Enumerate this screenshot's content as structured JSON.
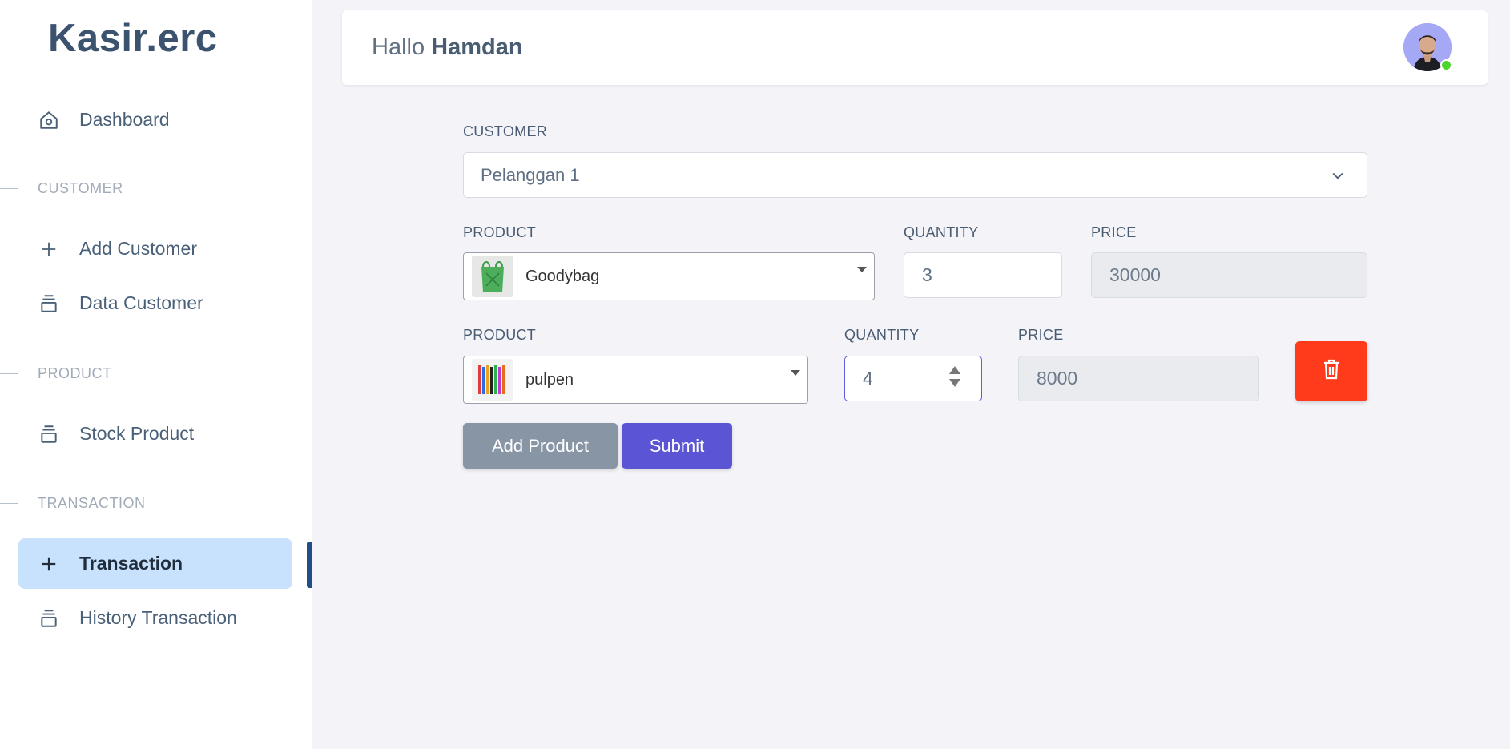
{
  "app": {
    "brand": "Kasir.erc"
  },
  "sidebar": {
    "dashboard": "Dashboard",
    "sections": {
      "customer": "CUSTOMER",
      "product": "PRODUCT",
      "transaction": "TRANSACTION"
    },
    "items": {
      "add_customer": "Add Customer",
      "data_customer": "Data Customer",
      "stock_product": "Stock Product",
      "transaction": "Transaction",
      "history_transaction": "History Transaction"
    }
  },
  "header": {
    "greeting_prefix": "Hallo",
    "user_name": "Hamdan"
  },
  "form": {
    "customer_label": "CUSTOMER",
    "customer_value": "Pelanggan 1",
    "rows": [
      {
        "product_label": "PRODUCT",
        "product_value": "Goodybag",
        "quantity_label": "QUANTITY",
        "quantity_value": "3",
        "price_label": "PRICE",
        "price_value": "30000"
      },
      {
        "product_label": "PRODUCT",
        "product_value": "pulpen",
        "quantity_label": "QUANTITY",
        "quantity_value": "4",
        "price_label": "PRICE",
        "price_value": "8000"
      }
    ],
    "add_product_label": "Add Product",
    "submit_label": "Submit"
  },
  "colors": {
    "accent": "#5b55d6",
    "danger": "#ff3b1c",
    "active_nav": "#c8e2fd",
    "online": "#4cd52c"
  }
}
